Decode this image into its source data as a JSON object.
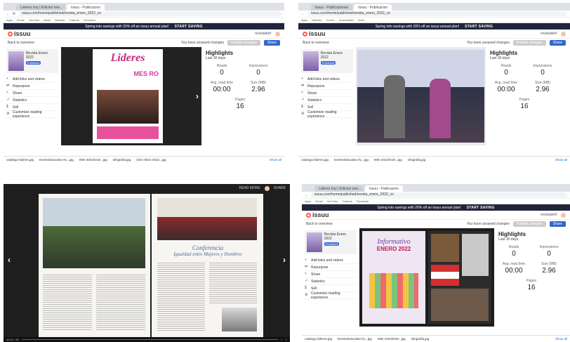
{
  "browser": {
    "tab1_label": "Lideres hoy | Edicion ene...",
    "tab2_label": "Issuu - Publicaciones",
    "tab3_label": "Issuu - Publicacion",
    "url": "issuu.com/home/published/revista_enero_2022_co",
    "bookmarks": [
      "Apps",
      "Gmail",
      "YouTube",
      "Maps",
      "Noticias",
      "Traducir",
      "Facebook",
      "Correo",
      "Universidad",
      "Drive"
    ]
  },
  "promo": {
    "text": "Spring into savings with 20% off an issuu annual plan!",
    "cta": "START SAVING"
  },
  "issuu": {
    "logo": "issuu",
    "user": "revistadetf",
    "back_link": "Back to overview",
    "unsaved": "You have unsaved changes",
    "publish_btn": "Publish changes",
    "share_btn": "Share",
    "pub_title": "Revista Enero 2022",
    "pub_tag": "Published",
    "menu": [
      "Add links and videos",
      "Repurpose",
      "Share",
      "Statistics",
      "Sell",
      "Customize reading experience"
    ],
    "highlights_title": "Highlights",
    "highlights_sub": "Last 30 days",
    "reads_label": "Reads",
    "reads_value": "0",
    "impressions_label": "Impressions",
    "impressions_value": "0",
    "avg_time_label": "Avg. read time",
    "avg_time_value": "00:00",
    "size_label": "Size (MB)",
    "size_value": "2.96",
    "pages_label": "Pages",
    "pages_value": "16"
  },
  "cover": {
    "title": "Lideres",
    "subtitle": "MES RO"
  },
  "downloads": [
    "catalogo-lideres.jpg",
    "EventoEducativo-fu...jpg",
    "IMG-20220218...jpg",
    "infografia.jpg",
    "DSC-0021-2022...jpg"
  ],
  "downloads_all": "Show all",
  "reader": {
    "top_left": "READ MORE",
    "top_right": "SHARE",
    "conference_title": "Conferencia",
    "conference_sub": "Igualdad entre Mujeres y Hombres",
    "page_indicator": "10-11 / 16"
  },
  "q4_cover": {
    "title": "Informativo",
    "subtitle": "ENERO 2022"
  }
}
